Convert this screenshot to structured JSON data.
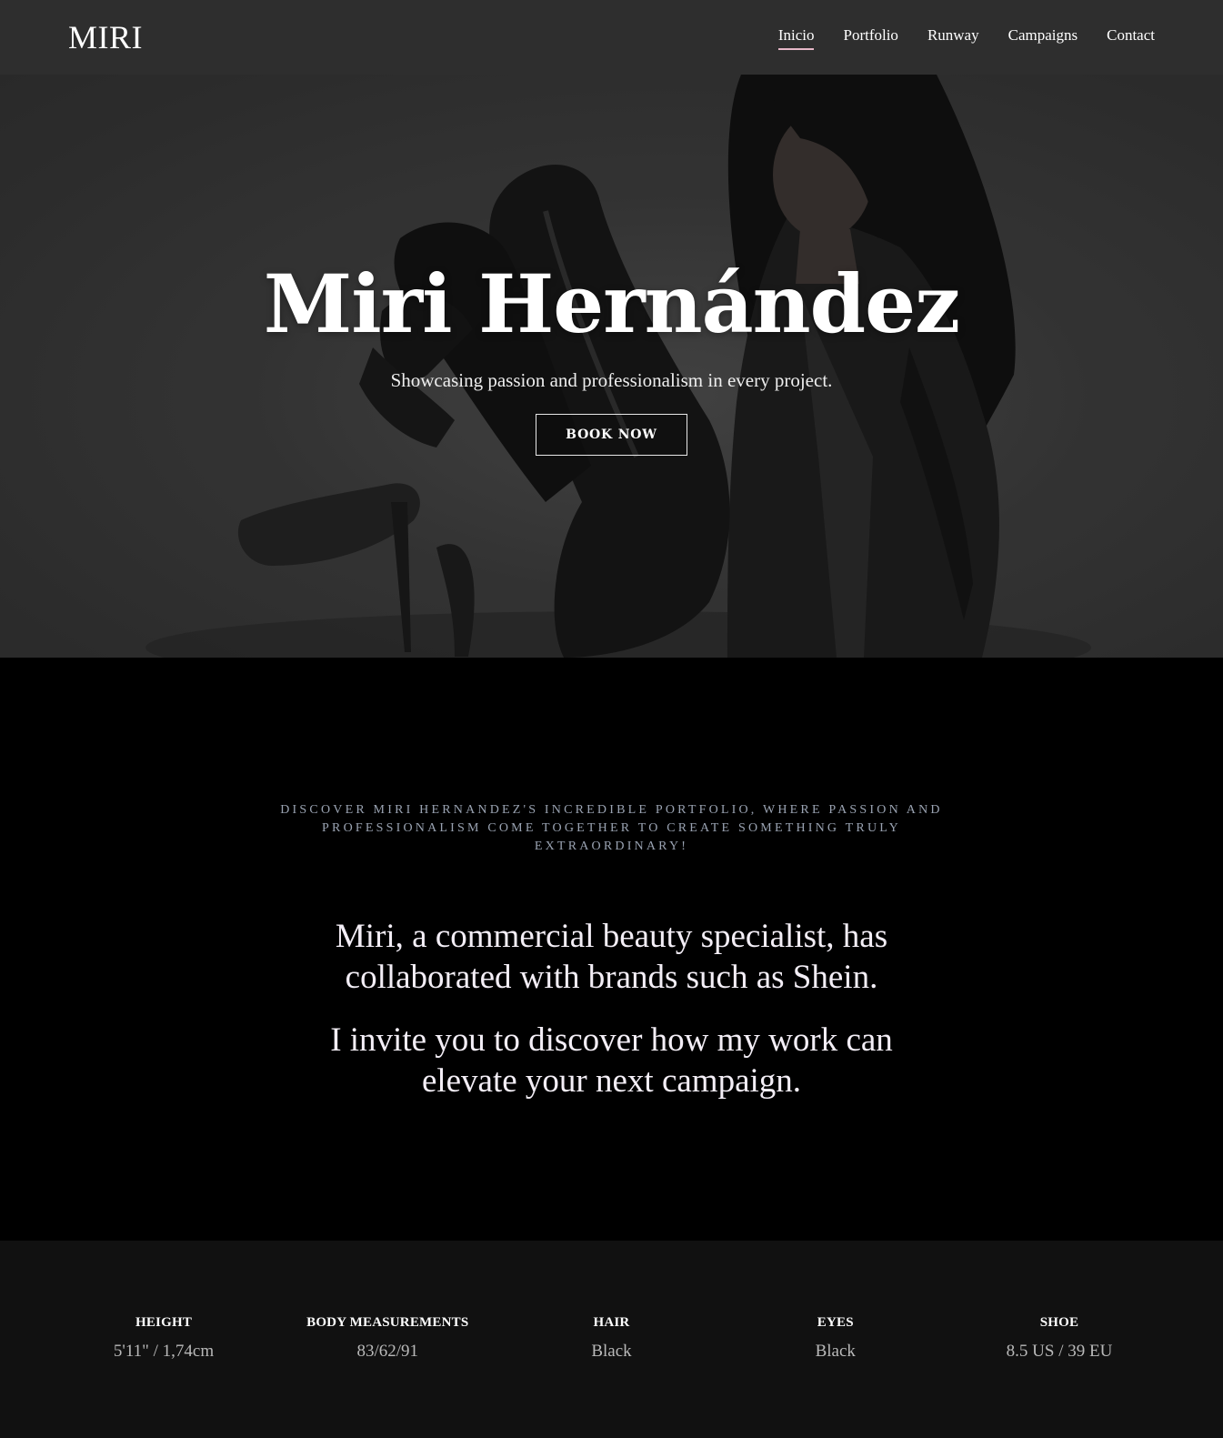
{
  "header": {
    "logo": "MIRI",
    "nav": [
      {
        "label": "Inicio",
        "active": true
      },
      {
        "label": "Portfolio",
        "active": false
      },
      {
        "label": "Runway",
        "active": false
      },
      {
        "label": "Campaigns",
        "active": false
      },
      {
        "label": "Contact",
        "active": false
      }
    ],
    "accent_color": "#e6b8c8"
  },
  "hero": {
    "title": "Miri Hernández",
    "subtitle": "Showcasing passion and professionalism in every project.",
    "cta_label": "BOOK NOW"
  },
  "intro": {
    "kicker": "DISCOVER MIRI HERNANDEZ'S INCREDIBLE PORTFOLIO, WHERE PASSION AND PROFESSIONALISM COME TOGETHER TO CREATE SOMETHING TRULY EXTRAORDINARY!",
    "paragraphs": [
      "Miri, a commercial beauty specialist, has collaborated with brands such as Shein.",
      "I invite you to discover how my work can elevate your next campaign."
    ]
  },
  "stats": [
    {
      "label": "HEIGHT",
      "value": "5'11\" / 1,74cm"
    },
    {
      "label": "BODY MEASUREMENTS",
      "value": "83/62/91"
    },
    {
      "label": "HAIR",
      "value": "Black"
    },
    {
      "label": "EYES",
      "value": "Black"
    },
    {
      "label": "SHOE",
      "value": "8.5 US / 39 EU"
    }
  ]
}
